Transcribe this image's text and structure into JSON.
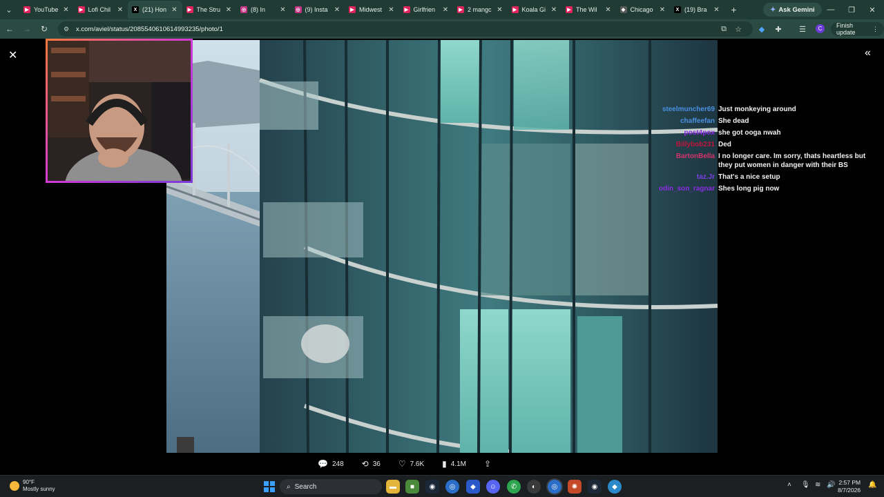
{
  "browser": {
    "tabs": [
      {
        "label": "YouTube",
        "color": "#e0245e",
        "icon": "youtube-icon",
        "active": false
      },
      {
        "label": "Lofi Chil",
        "color": "#e0245e",
        "icon": "youtube-icon",
        "active": false
      },
      {
        "label": "(21) Hon",
        "color": "#000000",
        "icon": "x-icon",
        "active": true
      },
      {
        "label": "The Stru",
        "color": "#e0245e",
        "icon": "youtube-icon",
        "active": false
      },
      {
        "label": "(8) In",
        "color": "#c13584",
        "icon": "instagram-icon",
        "active": false
      },
      {
        "label": "(9) Insta",
        "color": "#c13584",
        "icon": "instagram-icon",
        "active": false
      },
      {
        "label": "Midwest",
        "color": "#e0245e",
        "icon": "youtube-icon",
        "active": false
      },
      {
        "label": "Girlfrien",
        "color": "#e0245e",
        "icon": "youtube-icon",
        "active": false
      },
      {
        "label": "2 mangc",
        "color": "#e0245e",
        "icon": "youtube-icon",
        "active": false
      },
      {
        "label": "Koala Gi",
        "color": "#e0245e",
        "icon": "youtube-icon",
        "active": false
      },
      {
        "label": "The Wil",
        "color": "#e0245e",
        "icon": "youtube-icon",
        "active": false
      },
      {
        "label": "Chicago",
        "color": "#5a5a5a",
        "icon": "page-icon",
        "active": false
      },
      {
        "label": "(19) Bra",
        "color": "#000000",
        "icon": "x-icon",
        "active": false
      }
    ],
    "ask_gemini": "Ask Gemini",
    "url": "x.com/aviel/status/2085540610614993235/photo/1",
    "finish_update": "Finish update",
    "profile_initial": "C"
  },
  "chat": [
    {
      "user": "steelmuncher69",
      "color": "#4a90e2",
      "msg": "Just monkeying around"
    },
    {
      "user": "chaffeefan",
      "color": "#4a90e2",
      "msg": "She dead"
    },
    {
      "user": "post4pox",
      "color": "#8a2be2",
      "msg": "she got ooga nwah"
    },
    {
      "user": "Billybob231",
      "color": "#c0143c",
      "msg": "Ded"
    },
    {
      "user": "BartonBella",
      "color": "#d6336c",
      "msg": "I no longer care. Im sorry, thats heartless but they put women in danger with their BS"
    },
    {
      "user": "taz.Jr",
      "color": "#7b3fe4",
      "msg": "That's a nice setup"
    },
    {
      "user": "odin_son_ragnar",
      "color": "#8a2be2",
      "msg": "Shes long pig now"
    }
  ],
  "actions": {
    "replies": "248",
    "reposts": "36",
    "likes": "7.6K",
    "views": "4.1M"
  },
  "taskbar": {
    "temp": "90°F",
    "weather": "Mostly sunny",
    "search_placeholder": "Search",
    "time": "2:57 PM",
    "date": "8/7/2026"
  }
}
